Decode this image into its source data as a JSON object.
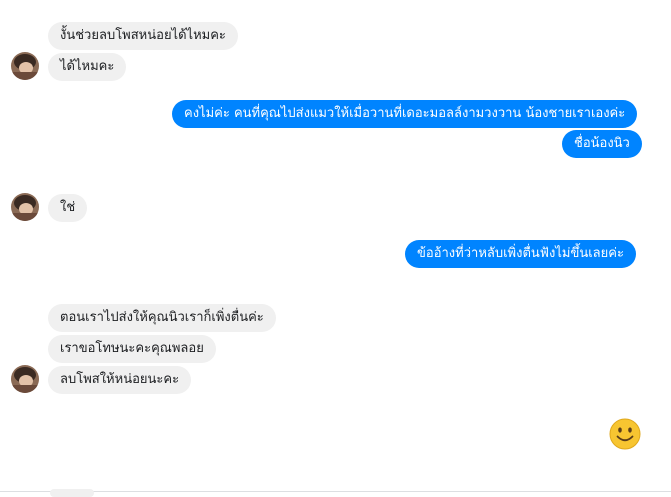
{
  "messages": {
    "in1": "งั้นช่วยลบโพสหน่อยได้ไหมคะ",
    "in2": "ได้ไหมคะ",
    "out1": "คงไม่ค่ะ คนที่คุณไปส่งแมวให้เมื่อวานที่เดอะมอลล์งามวงวาน น้องชายเราเองค่ะ",
    "out2": "ชื่อน้องนิว",
    "in3": "ใช่",
    "out3": "ข้ออ้างที่ว่าหลับเพิ่งตื่นฟังไม่ขึ้นเลยค่ะ",
    "in4": "ตอนเราไปส่งให้คุณนิวเราก็เพิ่งตื่นค่ะ",
    "in5": "เราขอโทษนะคะคุณพลอย",
    "in6": "ลบโพสให้หน่อยนะคะ"
  },
  "icons": {
    "avatar": "contact-avatar",
    "emoji": "smile-emoji-icon"
  },
  "colors": {
    "incoming_bubble": "#f0f0f0",
    "outgoing_bubble": "#0084ff",
    "outgoing_text": "#ffffff"
  }
}
